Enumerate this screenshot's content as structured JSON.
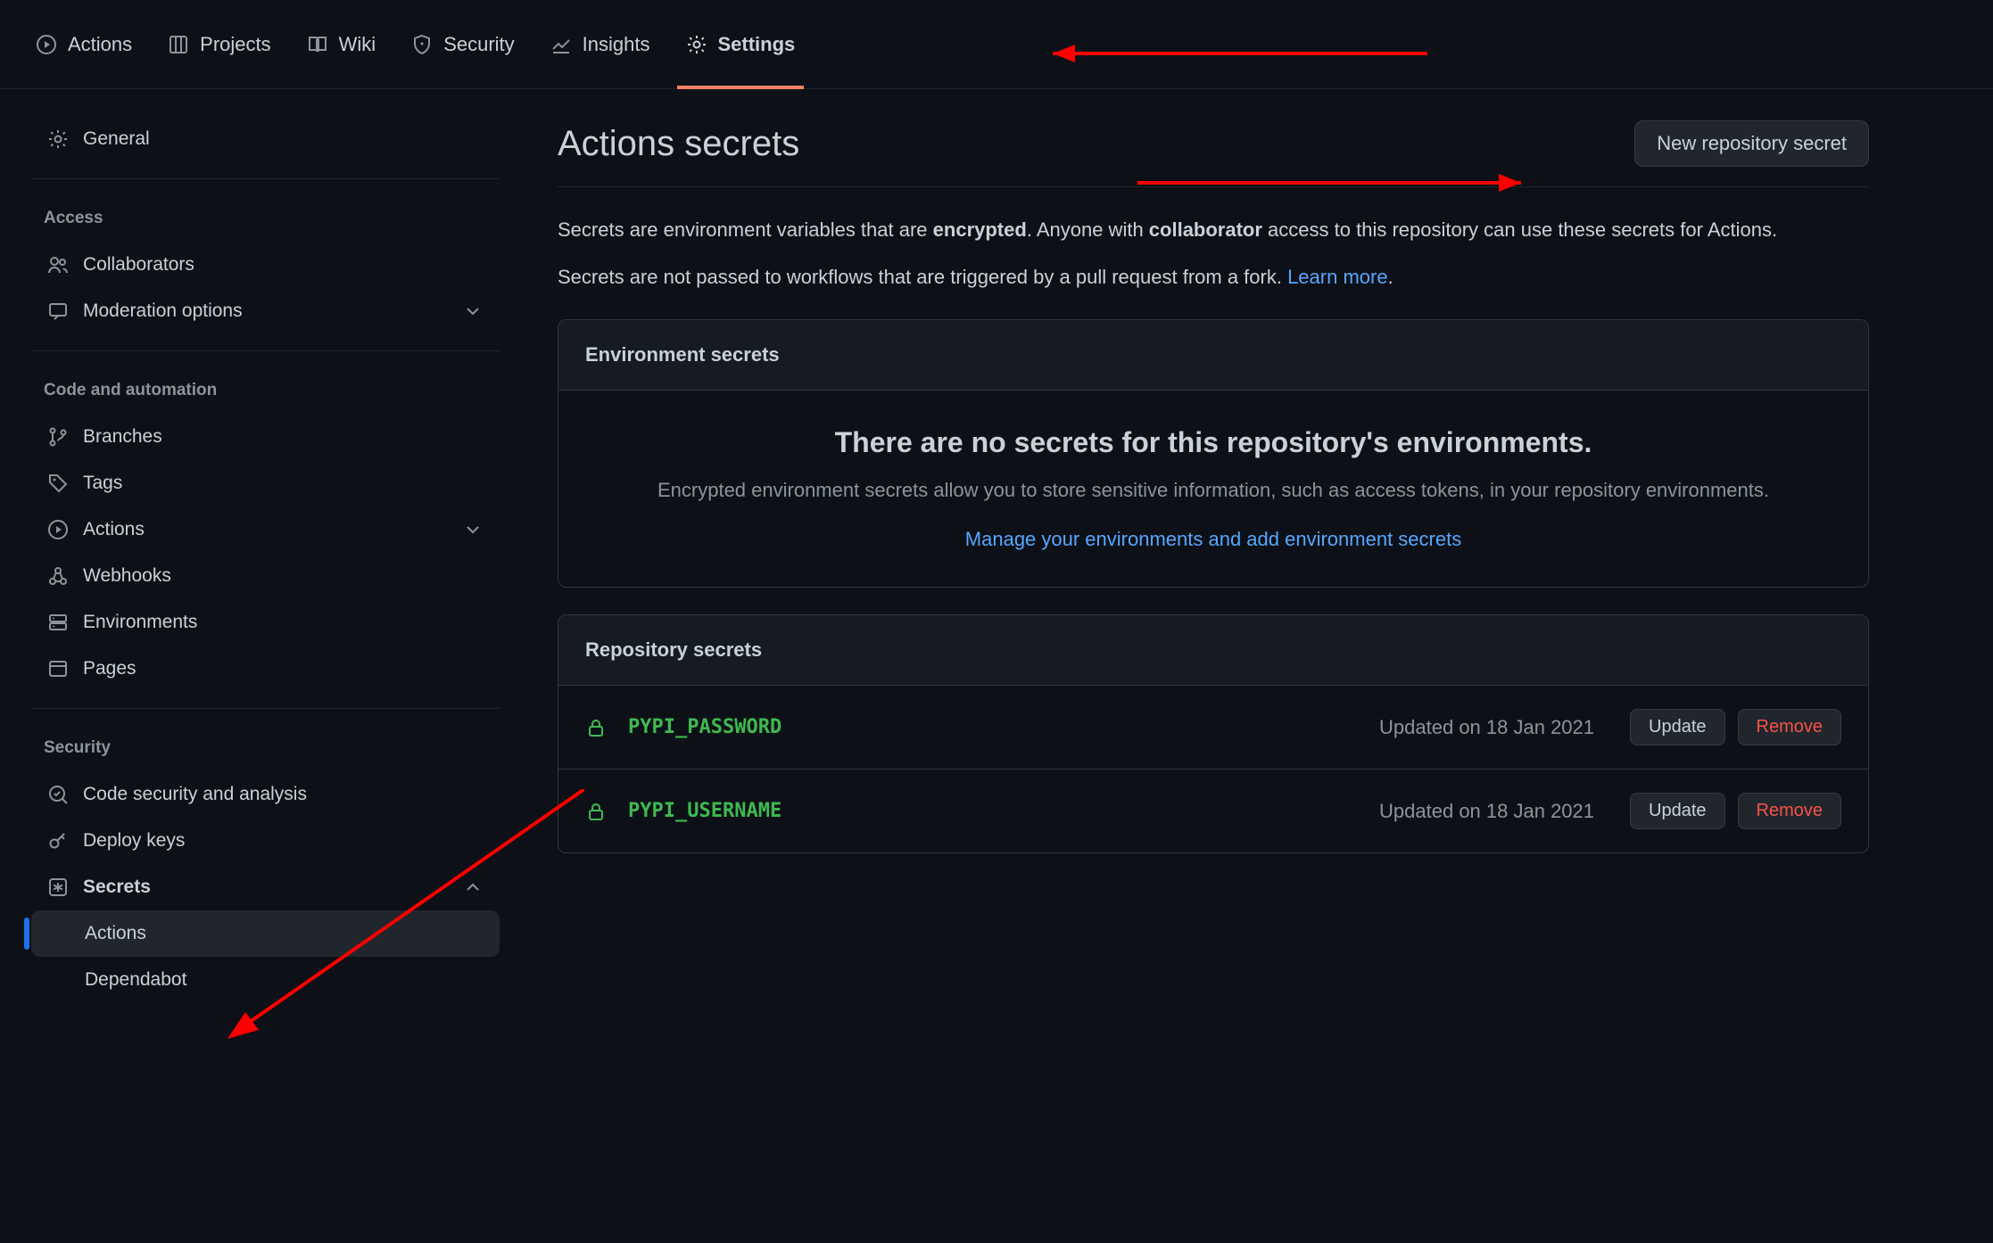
{
  "topnav": [
    {
      "label": "Actions",
      "icon": "play"
    },
    {
      "label": "Projects",
      "icon": "project"
    },
    {
      "label": "Wiki",
      "icon": "book"
    },
    {
      "label": "Security",
      "icon": "shield"
    },
    {
      "label": "Insights",
      "icon": "graph"
    },
    {
      "label": "Settings",
      "icon": "gear",
      "active": true
    }
  ],
  "sidebar": {
    "general_label": "General",
    "sections": [
      {
        "heading": "Access",
        "items": [
          {
            "label": "Collaborators",
            "icon": "people"
          },
          {
            "label": "Moderation options",
            "icon": "comment",
            "chev": true
          }
        ]
      },
      {
        "heading": "Code and automation",
        "items": [
          {
            "label": "Branches",
            "icon": "branch"
          },
          {
            "label": "Tags",
            "icon": "tag"
          },
          {
            "label": "Actions",
            "icon": "play",
            "chev": true
          },
          {
            "label": "Webhooks",
            "icon": "webhook"
          },
          {
            "label": "Environments",
            "icon": "server"
          },
          {
            "label": "Pages",
            "icon": "browser"
          }
        ]
      },
      {
        "heading": "Security",
        "items": [
          {
            "label": "Code security and analysis",
            "icon": "codescan"
          },
          {
            "label": "Deploy keys",
            "icon": "key"
          },
          {
            "label": "Secrets",
            "icon": "asterisk",
            "chev_up": true,
            "bold": true,
            "sub": [
              {
                "label": "Actions",
                "selected": true
              },
              {
                "label": "Dependabot"
              }
            ]
          }
        ]
      }
    ]
  },
  "page": {
    "title": "Actions secrets",
    "new_button": "New repository secret",
    "desc_plain_1": "Secrets are environment variables that are ",
    "desc_bold_1": "encrypted",
    "desc_plain_2": ". Anyone with ",
    "desc_bold_2": "collaborator",
    "desc_plain_3": " access to this repository can use these secrets for Actions.",
    "desc2_plain": "Secrets are not passed to workflows that are triggered by a pull request from a fork. ",
    "desc2_link": "Learn more",
    "desc2_dot": ".",
    "env_panel": {
      "title": "Environment secrets",
      "empty_title": "There are no secrets for this repository's environments.",
      "empty_desc": "Encrypted environment secrets allow you to store sensitive information, such as access tokens, in your repository environments.",
      "empty_link": "Manage your environments and add environment secrets"
    },
    "repo_panel": {
      "title": "Repository secrets",
      "rows": [
        {
          "name": "PYPI_PASSWORD",
          "meta": "Updated on 18 Jan 2021",
          "update": "Update",
          "remove": "Remove"
        },
        {
          "name": "PYPI_USERNAME",
          "meta": "Updated on 18 Jan 2021",
          "update": "Update",
          "remove": "Remove"
        }
      ]
    }
  }
}
